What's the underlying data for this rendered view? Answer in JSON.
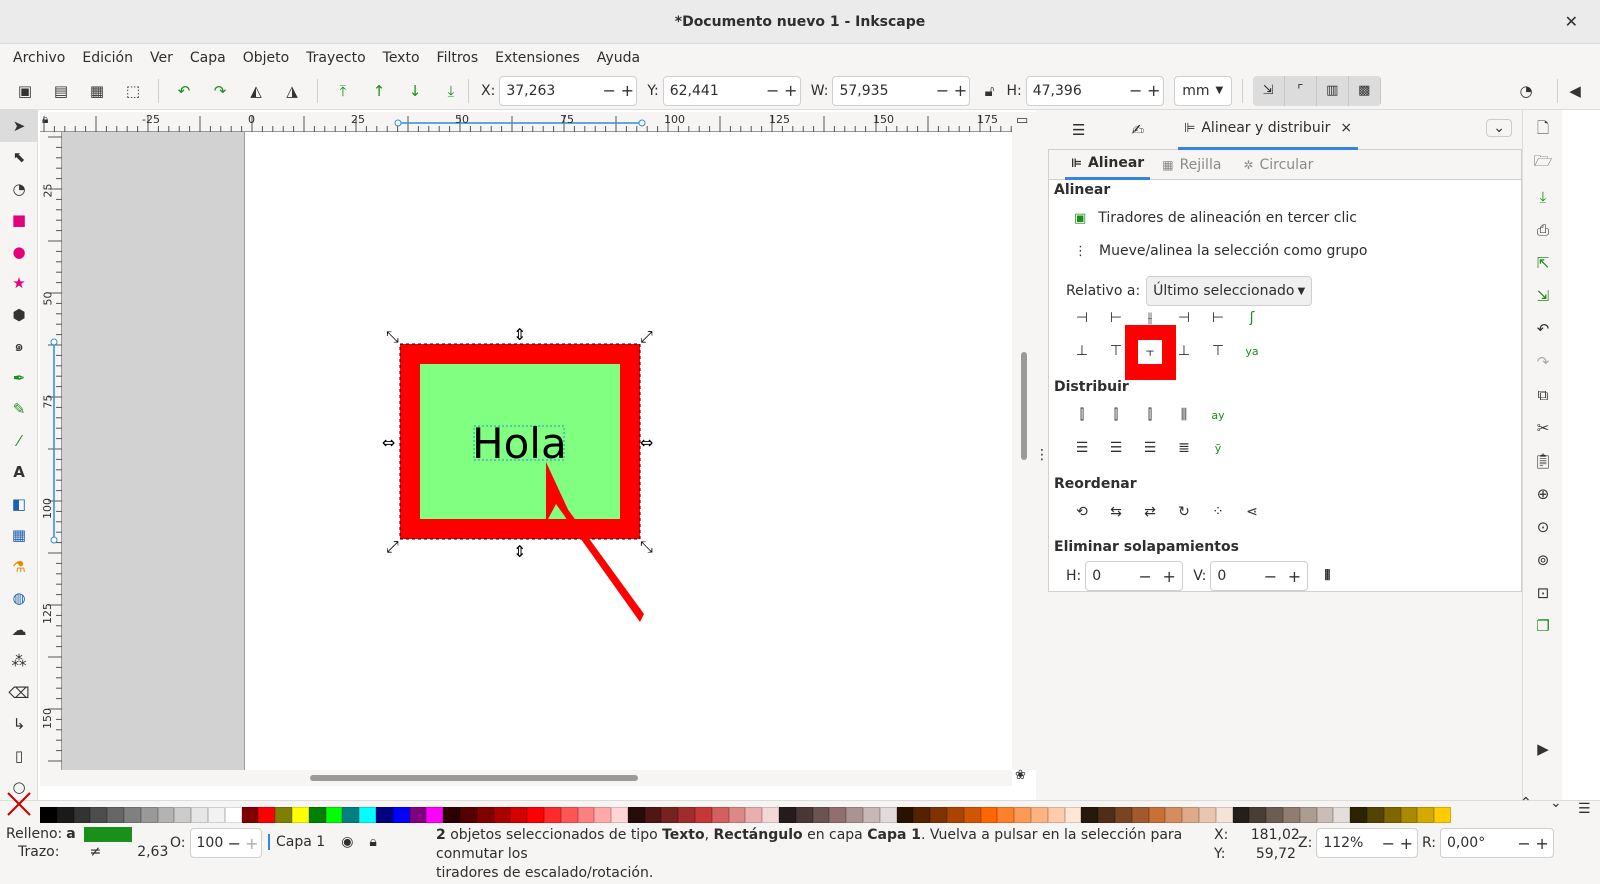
{
  "window": {
    "title": "*Documento nuevo 1 - Inkscape",
    "close_glyph": "✕"
  },
  "menu": [
    "Archivo",
    "Edición",
    "Ver",
    "Capa",
    "Objeto",
    "Trayecto",
    "Texto",
    "Filtros",
    "Extensiones",
    "Ayuda"
  ],
  "toolbar": {
    "x_label": "X:",
    "x_value": "37,263",
    "y_label": "Y:",
    "y_value": "62,441",
    "w_label": "W:",
    "w_value": "57,935",
    "h_label": "H:",
    "h_value": "47,396",
    "unit": "mm",
    "minus": "−",
    "plus": "+"
  },
  "ruler_top_labels": [
    "-25",
    "0",
    "25",
    "50",
    "75",
    "100",
    "125",
    "150",
    "175"
  ],
  "ruler_left_labels": [
    "25",
    "50",
    "75",
    "100",
    "125",
    "150"
  ],
  "canvas": {
    "text": "Hola",
    "rect_fill": "#80ff80",
    "rect_stroke": "#ff0000",
    "arrow_color": "#ff0000"
  },
  "panel": {
    "tabs": {
      "active_label": "Alinear y distribuir",
      "close": "×"
    },
    "subtabs": [
      "Alinear",
      "Rejilla",
      "Circular"
    ],
    "align_heading": "Alinear",
    "opt1": "Tiradores de alineación en tercer clic",
    "opt2": "Mueve/alinea la selección como grupo",
    "relative_label": "Relativo a:",
    "relative_value": "Último seleccionado",
    "distribute_heading": "Distribuir",
    "reorder_heading": "Reordenar",
    "overlap_heading": "Eliminar solapamientos",
    "h_label": "H:",
    "h_value": "0",
    "v_label": "V:",
    "v_value": "0",
    "highlight_color": "#ff0000"
  },
  "palette_colors": [
    "#000000",
    "#1a1a1a",
    "#333333",
    "#4d4d4d",
    "#666666",
    "#808080",
    "#999999",
    "#b3b3b3",
    "#cccccc",
    "#e6e6e6",
    "#f2f2f2",
    "#ffffff",
    "#800000",
    "#ff0000",
    "#808000",
    "#ffff00",
    "#008000",
    "#00ff00",
    "#008080",
    "#00ffff",
    "#000080",
    "#0000ff",
    "#800080",
    "#ff00ff",
    "#2b0000",
    "#550000",
    "#800000",
    "#aa0000",
    "#d40000",
    "#ff0000",
    "#ff2a2a",
    "#ff5555",
    "#ff8080",
    "#ffaaaa",
    "#ffd5d5",
    "#280b0b",
    "#501616",
    "#782121",
    "#a02c2c",
    "#c83737",
    "#d35f5f",
    "#de8787",
    "#e9afaf",
    "#f4d7d7",
    "#241c1c",
    "#483737",
    "#6c5353",
    "#916f6f",
    "#ac9393",
    "#c8b7b7",
    "#e3dbdb",
    "#2b1100",
    "#552200",
    "#803300",
    "#aa4400",
    "#d45500",
    "#ff6600",
    "#ff7f2a",
    "#ff9955",
    "#ffb380",
    "#ffccaa",
    "#ffe6d5",
    "#28170b",
    "#502d16",
    "#784421",
    "#a05a2c",
    "#c87137",
    "#d38d5f",
    "#deaa87",
    "#e9c6af",
    "#f4e3d7",
    "#241f1c",
    "#483e37",
    "#6c5d53",
    "#917c6f",
    "#ac9d93",
    "#c8beb7",
    "#e3dedb",
    "#2b2200",
    "#554400",
    "#806600",
    "#aa8800",
    "#d4aa00",
    "#ffcc00"
  ],
  "status": {
    "fill_label": "Relleno:",
    "fill_value": "a",
    "fill_color": "#1a8f1a",
    "stroke_label": "Trazo:",
    "stroke_value": "≠",
    "stroke_width": "2,63",
    "opacity_label": "O:",
    "opacity_value": "100",
    "layer": "Capa 1",
    "message_bold1": "2",
    "message_part1": " objetos seleccionados de tipo ",
    "message_bold2": "Texto",
    "message_part2": ", ",
    "message_bold3": "Rectángulo",
    "message_part3": " en capa ",
    "message_bold4": "Capa 1",
    "message_part4": ". Vuelva a pulsar en la selección para conmutar los",
    "message_line2": "tiradores de escalado/rotación.",
    "cx_label": "X:",
    "cx_value": "181,02",
    "cy_label": "Y:",
    "cy_value": "59,72",
    "zoom_label": "Z:",
    "zoom_value": "112%",
    "rot_label": "R:",
    "rot_value": "0,00°"
  }
}
